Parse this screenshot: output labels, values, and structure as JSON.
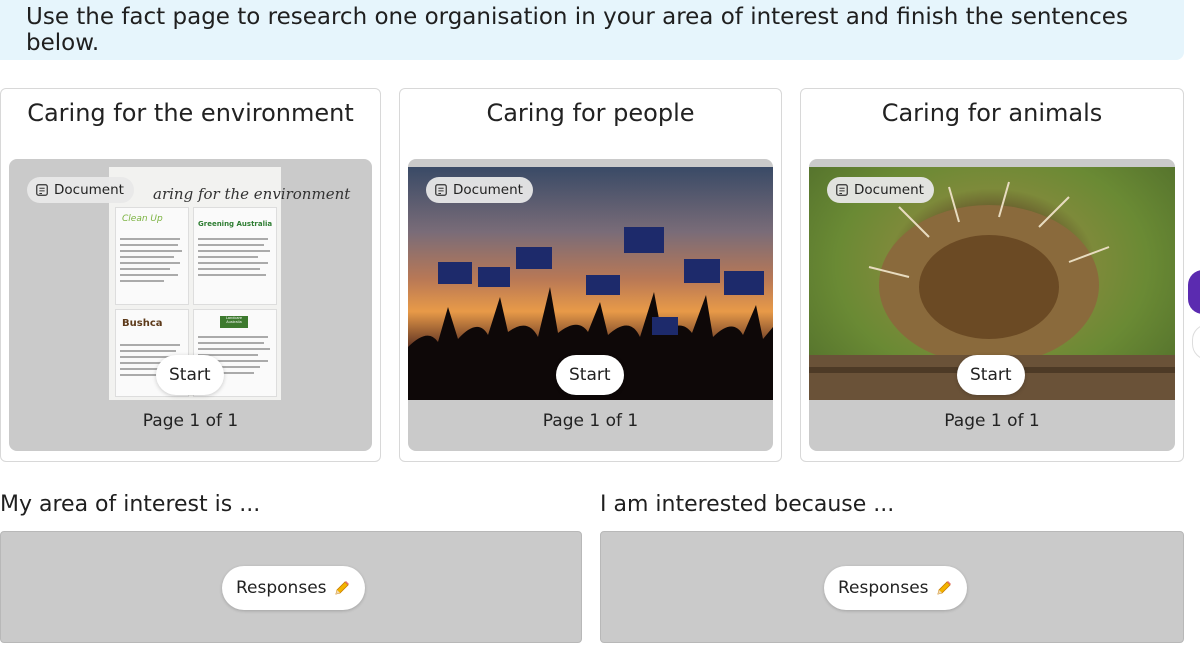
{
  "instruction": "Use the fact page to research one organisation in your area of interest and finish the sentences below.",
  "cards": [
    {
      "title": "Caring for the environment",
      "chip_label": "Document",
      "start_label": "Start",
      "page_label": "Page 1 of 1",
      "doc_heading": "aring for the environment",
      "doc_sections": [
        "Clean Up",
        "Greening Australia",
        "Bushca",
        "Landcare Australia"
      ]
    },
    {
      "title": "Caring for people",
      "chip_label": "Document",
      "start_label": "Start",
      "page_label": "Page 1 of 1"
    },
    {
      "title": "Caring for animals",
      "chip_label": "Document",
      "start_label": "Start",
      "page_label": "Page 1 of 1"
    }
  ],
  "prompts": [
    {
      "label": "My area of interest is ...",
      "button": "Responses",
      "icon": "pencil-icon"
    },
    {
      "label": "I am interested because ...",
      "button": "Responses",
      "icon": "pencil-icon"
    }
  ],
  "colors": {
    "banner": "#e6f5fc",
    "preview": "#cacaca",
    "side_button": "#5b2bb0"
  }
}
